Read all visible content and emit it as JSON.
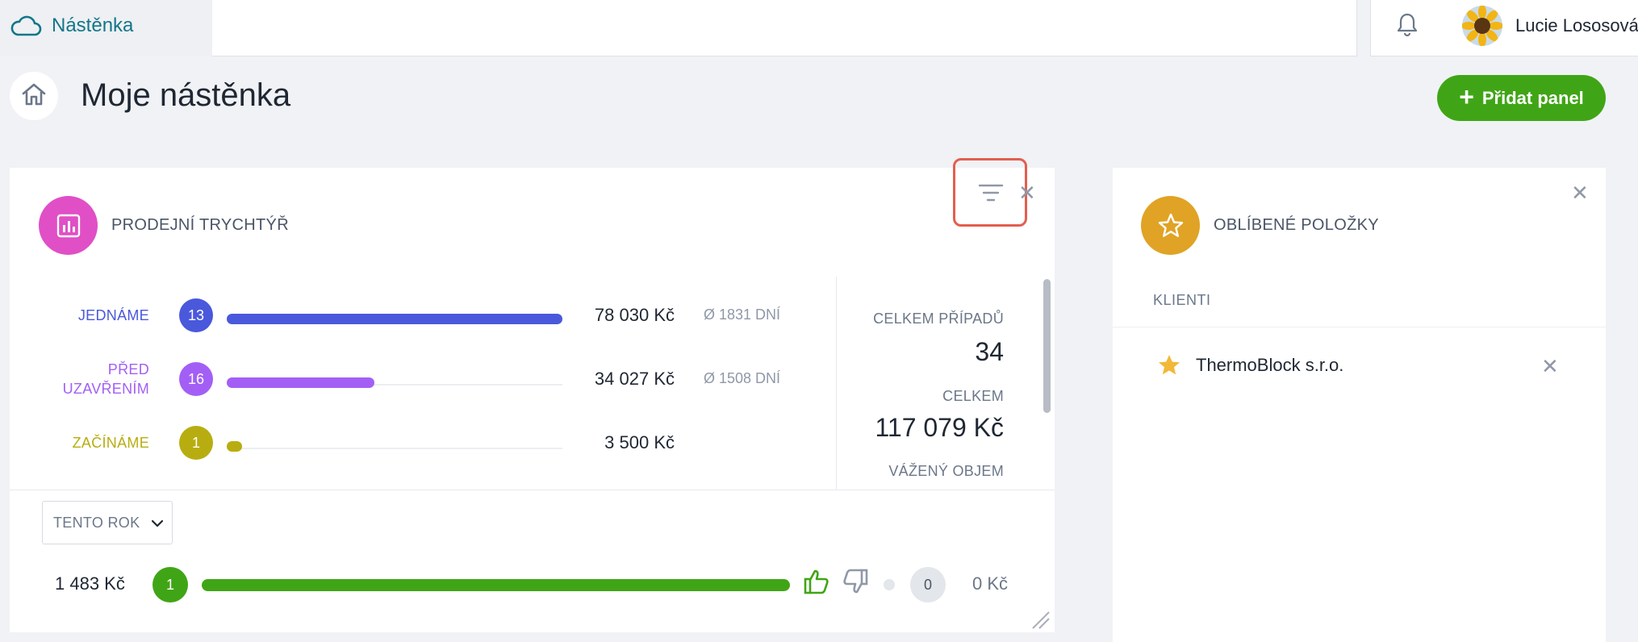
{
  "topbar": {
    "app_title": "Nástěnka",
    "user_name": "Lucie Lososová"
  },
  "header": {
    "page_title": "Moje nástěnka",
    "add_panel_label": "Přidat panel"
  },
  "funnel": {
    "title": "PRODEJNÍ TRYCHTÝŘ",
    "icon_color": "#e04fc6",
    "stages": [
      {
        "label_1": "JEDNÁME",
        "label_2": "",
        "count": "13",
        "amount": "78 030 Kč",
        "avg": "Ø 1831 DNÍ",
        "fill": 1.0,
        "color": "#4a58dc"
      },
      {
        "label_1": "PŘED",
        "label_2": "UZAVŘENÍM",
        "count": "16",
        "amount": "34 027 Kč",
        "avg": "Ø 1508 DNÍ",
        "fill": 0.44,
        "color": "#a35ff5"
      },
      {
        "label_1": "ZAČÍNÁME",
        "label_2": "",
        "count": "1",
        "amount": "3 500 Kč",
        "avg": "",
        "fill": 0.045,
        "color": "#b8ad10"
      }
    ],
    "stats": {
      "total_cases_label": "CELKEM PŘÍPADŮ",
      "total_cases_value": "34",
      "total_label": "CELKEM",
      "total_value": "117 079 Kč",
      "weighted_label": "VÁŽENÝ OBJEM"
    },
    "period": "TENTO ROK",
    "won_amount": "1 483 Kč",
    "won_count": "1",
    "lost_count": "0",
    "lost_amount": "0 Kč"
  },
  "favorites": {
    "title": "OBLÍBENÉ POLOŽKY",
    "icon_color": "#e0a325",
    "section": "KLIENTI",
    "items": [
      {
        "name": "ThermoBlock s.r.o."
      }
    ]
  }
}
